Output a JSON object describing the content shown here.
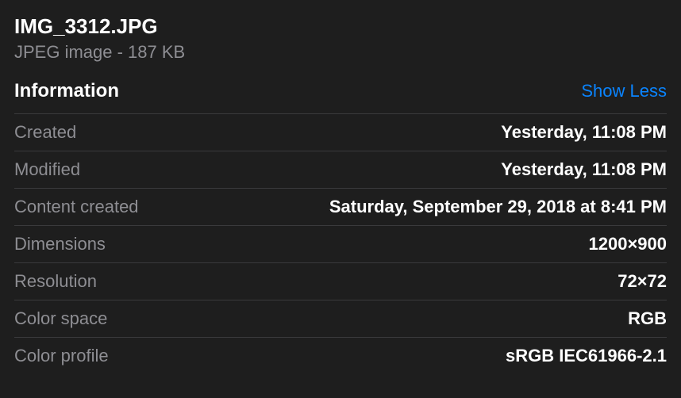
{
  "header": {
    "file_name": "IMG_3312.JPG",
    "file_meta": "JPEG image - 187 KB"
  },
  "section": {
    "title": "Information",
    "toggle_label": "Show Less"
  },
  "info": {
    "rows": [
      {
        "label": "Created",
        "value": "Yesterday, 11:08 PM"
      },
      {
        "label": "Modified",
        "value": "Yesterday, 11:08 PM"
      },
      {
        "label": "Content created",
        "value": "Saturday, September 29, 2018 at 8:41 PM"
      },
      {
        "label": "Dimensions",
        "value": "1200×900"
      },
      {
        "label": "Resolution",
        "value": "72×72"
      },
      {
        "label": "Color space",
        "value": "RGB"
      },
      {
        "label": "Color profile",
        "value": "sRGB IEC61966-2.1"
      }
    ]
  }
}
